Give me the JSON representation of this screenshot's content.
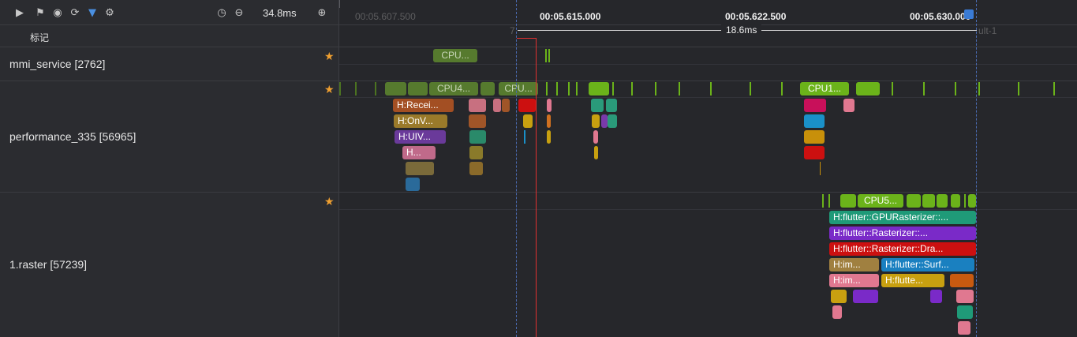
{
  "toolbar": {
    "zoom_label": "34.8ms",
    "icons": [
      "play-icon",
      "flag-icon",
      "network-icon",
      "refresh-icon",
      "filter-icon",
      "settings-icon",
      "timer-icon",
      "zoom-out-icon",
      "zoom-in-icon"
    ]
  },
  "marks_row": {
    "label": "标记"
  },
  "ruler": {
    "ticks": [
      "00:05.607.500",
      "00:05.615.000",
      "00:05.622.500",
      "00:05.630.000"
    ]
  },
  "range": {
    "label": "18.6ms",
    "left_marker": "7",
    "right_marker": "ult-1"
  },
  "lanes": [
    {
      "name": "mmi_service [2762]"
    },
    {
      "name": "performance_335 [56965]"
    },
    {
      "name": "1.raster [57239]"
    }
  ],
  "slices": {
    "mmi_cpu": "CPU...",
    "perf_cpu_a": "CPU4...",
    "perf_cpu_b": "CPU...",
    "perf_cpu_c": "CPU1...",
    "perf_s1": "H:Recei...",
    "perf_s2": "H:OnV...",
    "perf_s3": "H:UIV...",
    "perf_s4": "H...",
    "raster_cpu": "CPU5...",
    "raster_s1": "H:flutter::GPURasterizer::...",
    "raster_s2": "H:flutter::Rasterizer::...",
    "raster_s3": "H:flutter::Rasterizer::Dra...",
    "raster_s4a": "H:im...",
    "raster_s4b": "H:flutter::Surf...",
    "raster_s5a": "H:im...",
    "raster_s5b": "H:flutte..."
  },
  "colors": {
    "accent": "#3a7bd5",
    "cpu": "#6bb31a",
    "marker_red": "#e03030",
    "star": "#f0a030"
  }
}
